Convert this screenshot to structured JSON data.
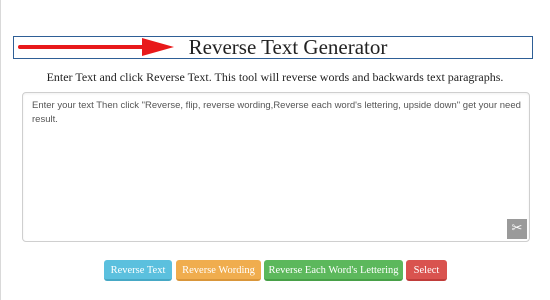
{
  "header": {
    "title": "Reverse Text Generator"
  },
  "subtitle": "Enter Text and click Reverse Text. This tool will reverse words and backwards text paragraphs.",
  "editor": {
    "text": "Enter your text Then click \"Reverse, flip, reverse wording,Reverse each word's lettering, upside down\" get your need result.",
    "handle_icon": "resize-icon"
  },
  "buttons": {
    "reverse_text": "Reverse Text",
    "reverse_wording": "Reverse Wording",
    "reverse_each": "Reverse Each Word's Lettering",
    "select": "Select"
  },
  "colors": {
    "arrow": "#e8191a",
    "title_border": "#2e5f96",
    "reverse_text_btn": "#5bc0de",
    "reverse_wording_btn": "#f0ad4e",
    "reverse_each_btn": "#5cb85c",
    "select_btn": "#d9534f"
  }
}
